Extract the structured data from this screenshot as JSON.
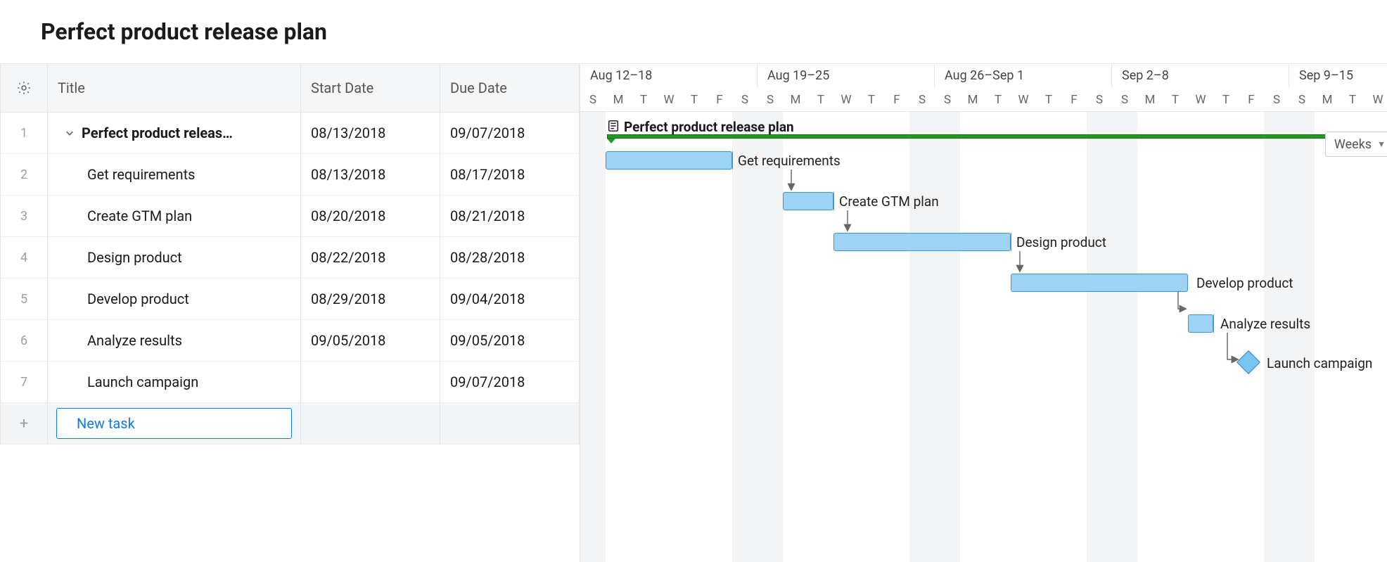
{
  "title": "Perfect product release plan",
  "columns": {
    "title": "Title",
    "start": "Start Date",
    "due": "Due Date"
  },
  "new_task_label": "New task",
  "scale_btn": "Weeks",
  "week_headers": [
    "Aug 12–18",
    "Aug 19–25",
    "Aug 26–Sep 1",
    "Sep 2–8",
    "Sep 9–15"
  ],
  "day_letters": [
    "S",
    "M",
    "T",
    "W",
    "T",
    "F",
    "S",
    "S",
    "M",
    "T",
    "W",
    "T",
    "F",
    "S",
    "S",
    "M",
    "T",
    "W",
    "T",
    "F",
    "S",
    "S",
    "M",
    "T",
    "W",
    "T",
    "F",
    "S",
    "S",
    "M",
    "T",
    "W"
  ],
  "project_bar_label": "Perfect product release plan",
  "rows": [
    {
      "n": "1",
      "title": "Perfect product releas…",
      "start": "08/13/2018",
      "due": "09/07/2018"
    },
    {
      "n": "2",
      "title": "Get requirements",
      "start": "08/13/2018",
      "due": "08/17/2018"
    },
    {
      "n": "3",
      "title": "Create GTM plan",
      "start": "08/20/2018",
      "due": "08/21/2018"
    },
    {
      "n": "4",
      "title": "Design product",
      "start": "08/22/2018",
      "due": "08/28/2018"
    },
    {
      "n": "5",
      "title": "Develop product",
      "start": "08/29/2018",
      "due": "09/04/2018"
    },
    {
      "n": "6",
      "title": "Analyze results",
      "start": "09/05/2018",
      "due": "09/05/2018"
    },
    {
      "n": "7",
      "title": "Launch campaign",
      "start": "",
      "due": "09/07/2018"
    }
  ],
  "chart_data": {
    "type": "bar",
    "title": "Perfect product release plan — Gantt",
    "unit": "day (36px each)",
    "x_origin": "2018-08-12",
    "series": [
      {
        "name": "Project",
        "start": "2018-08-13",
        "end": "2018-09-07",
        "summary": true
      },
      {
        "name": "Get requirements",
        "start": "2018-08-13",
        "end": "2018-08-17"
      },
      {
        "name": "Create GTM plan",
        "start": "2018-08-20",
        "end": "2018-08-21"
      },
      {
        "name": "Design product",
        "start": "2018-08-22",
        "end": "2018-08-28"
      },
      {
        "name": "Develop product",
        "start": "2018-08-29",
        "end": "2018-09-04"
      },
      {
        "name": "Analyze results",
        "start": "2018-09-05",
        "end": "2018-09-05"
      },
      {
        "name": "Launch campaign",
        "start": "2018-09-07",
        "end": "2018-09-07",
        "milestone": true
      }
    ],
    "dependencies": [
      [
        "Get requirements",
        "Create GTM plan"
      ],
      [
        "Create GTM plan",
        "Design product"
      ],
      [
        "Design product",
        "Develop product"
      ],
      [
        "Develop product",
        "Analyze results"
      ],
      [
        "Analyze results",
        "Launch campaign"
      ]
    ]
  }
}
